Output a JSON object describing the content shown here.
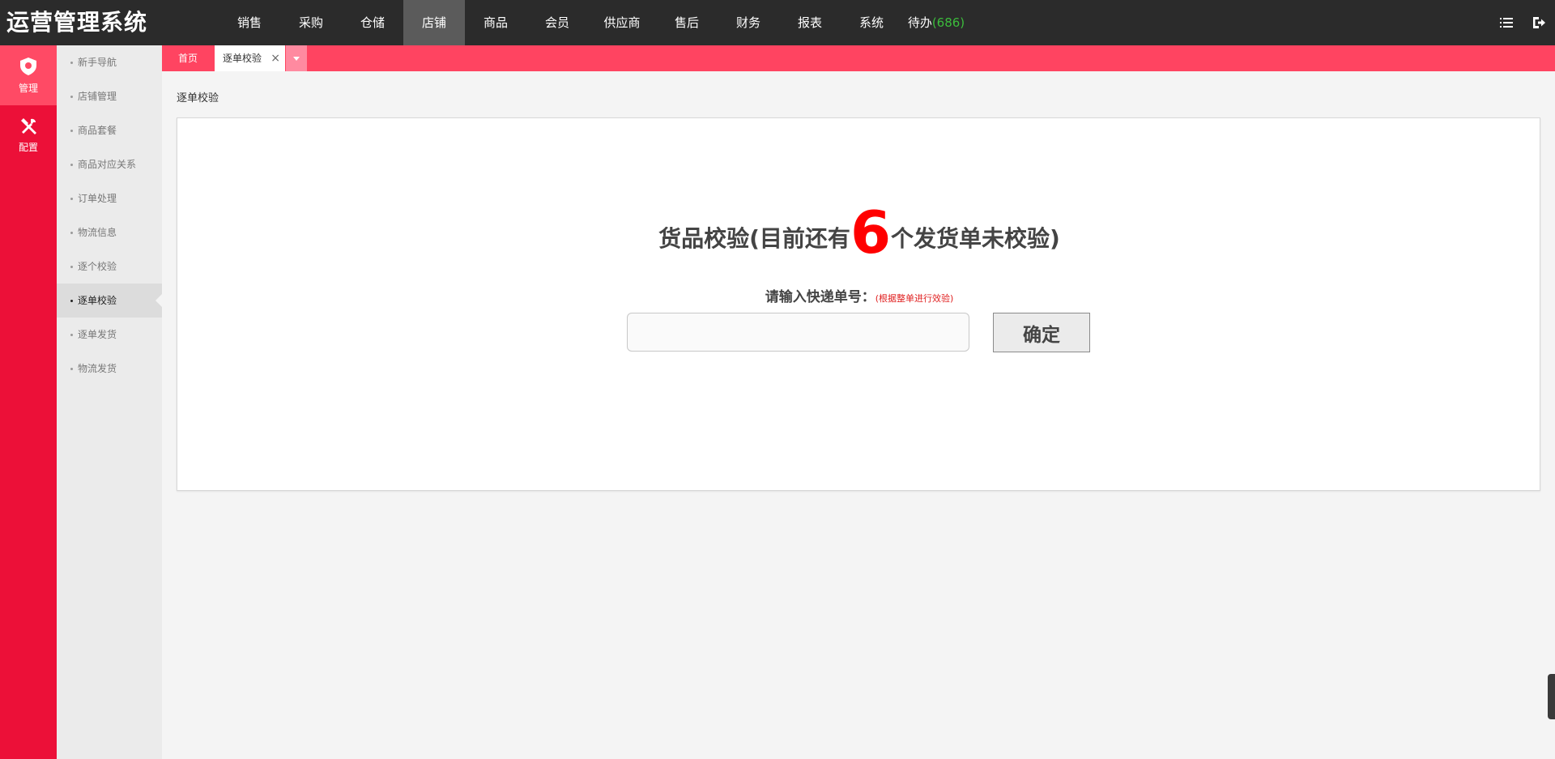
{
  "app": {
    "title": "运营管理系统"
  },
  "topnav": {
    "items": [
      {
        "label": "销售"
      },
      {
        "label": "采购"
      },
      {
        "label": "仓储"
      },
      {
        "label": "店铺",
        "active": true
      },
      {
        "label": "商品"
      },
      {
        "label": "会员"
      },
      {
        "label": "供应商"
      },
      {
        "label": "售后"
      },
      {
        "label": "财务"
      },
      {
        "label": "报表"
      },
      {
        "label": "系统"
      }
    ],
    "pending": {
      "label": "待办",
      "count": "(686)"
    }
  },
  "rail": {
    "items": [
      {
        "label": "管理",
        "icon": "shield-icon",
        "active": true
      },
      {
        "label": "配置",
        "icon": "tools-icon"
      }
    ]
  },
  "submenu": {
    "items": [
      {
        "label": "新手导航"
      },
      {
        "label": "店铺管理"
      },
      {
        "label": "商品套餐"
      },
      {
        "label": "商品对应关系"
      },
      {
        "label": "订单处理"
      },
      {
        "label": "物流信息"
      },
      {
        "label": "逐个校验"
      },
      {
        "label": "逐单校验",
        "active": true
      },
      {
        "label": "逐单发货"
      },
      {
        "label": "物流发货"
      }
    ]
  },
  "tabs": {
    "home": "首页",
    "current": "逐单校验",
    "close": "×"
  },
  "page": {
    "breadcrumb": "逐单校验",
    "heading_before": "货品校验(目前还有",
    "heading_count": "6",
    "heading_after": "个发货单未校验)",
    "prompt": "请输入快递单号：",
    "prompt_hint": "(根据整单进行效验)",
    "input_value": "",
    "input_placeholder": "",
    "confirm_label": "确定"
  },
  "colors": {
    "topbar": "#2b2b2b",
    "accent": "#ec1038",
    "tabbar": "#ff4461",
    "count": "#ff0000",
    "pending": "#3cbc3c"
  }
}
